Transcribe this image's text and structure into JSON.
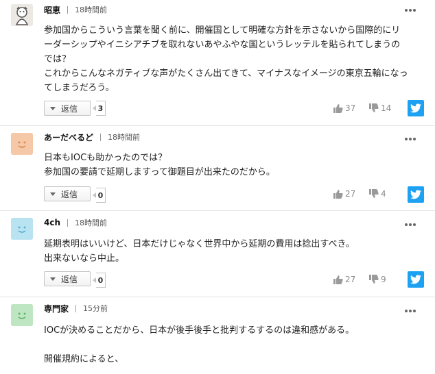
{
  "reply_label": "返信",
  "colors": {
    "twitter": "#1da1f2",
    "vote_icon": "#9a9a9a"
  },
  "comments": [
    {
      "username": "昭恵",
      "time": "18時間前",
      "avatar": "character-illustration",
      "lines": [
        "参加国からこういう言葉を聞く前に、開催国として明確な方針を示さないから国際的にリ",
        "ーダーシップやイニシアチブを取れないあやふやな国というレッテルを貼られてしまうの",
        "では？",
        "これからこんなネガティブな声がたくさん出てきて、マイナスなイメージの東京五輪になっ",
        "てしまうだろう。"
      ],
      "reply_count": "3",
      "likes": "37",
      "dislikes": "14"
    },
    {
      "username": "あーだべるど",
      "time": "18時間前",
      "avatar": "smiley-orange",
      "lines": [
        "日本もIOCも助かったのでは？",
        "参加国の要請で延期しますって御題目が出来たのだから。"
      ],
      "reply_count": "0",
      "likes": "27",
      "dislikes": "4"
    },
    {
      "username": "4ch",
      "time": "18時間前",
      "avatar": "smiley-blue",
      "lines": [
        "延期表明はいいけど、日本だけじゃなく世界中から延期の費用は捻出すべき。",
        "出来ないなら中止。"
      ],
      "reply_count": "0",
      "likes": "27",
      "dislikes": "9"
    },
    {
      "username": "専門家",
      "time": "15分前",
      "avatar": "smiley-green",
      "lines": [
        "IOCが決めることだから、日本が後手後手と批判するするのは違和感がある。",
        "",
        "開催規約によると、"
      ]
    }
  ]
}
